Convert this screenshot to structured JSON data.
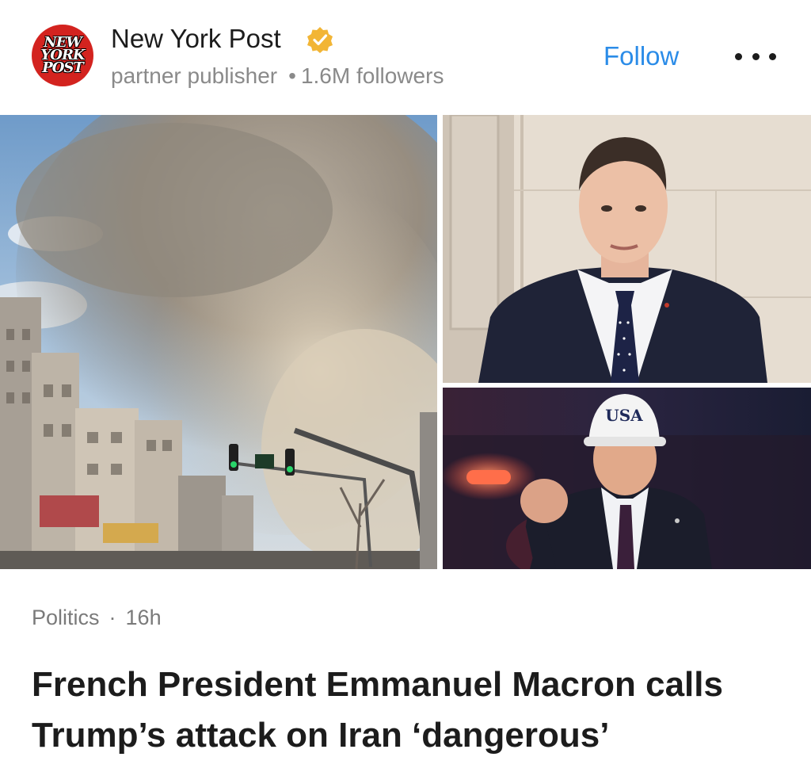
{
  "publisher": {
    "name": "New York Post",
    "logo_text": [
      "NEW",
      "YORK",
      "POST"
    ],
    "verified": true,
    "role": "partner publisher",
    "followers": "1.6M followers"
  },
  "actions": {
    "follow_label": "Follow",
    "more_icon": "more-horizontal-icon"
  },
  "images": {
    "main": "Smoke cloud rising over city street with traffic lights",
    "top_right": "Man in dark suit and dotted tie speaking",
    "bottom_right": "Man in white cap raising fist at night"
  },
  "image_text": {
    "cap": "USA"
  },
  "article": {
    "category": "Politics",
    "separator": "·",
    "time": "16h",
    "headline": "French President Emmanuel Macron calls Trump’s attack on Iran ‘dangerous’"
  },
  "colors": {
    "accent": "#2b8ce8",
    "logo_red": "#d3231f",
    "verified_gold": "#f2b535",
    "text_primary": "#1c1c1c",
    "text_secondary": "#8a8a8a"
  }
}
